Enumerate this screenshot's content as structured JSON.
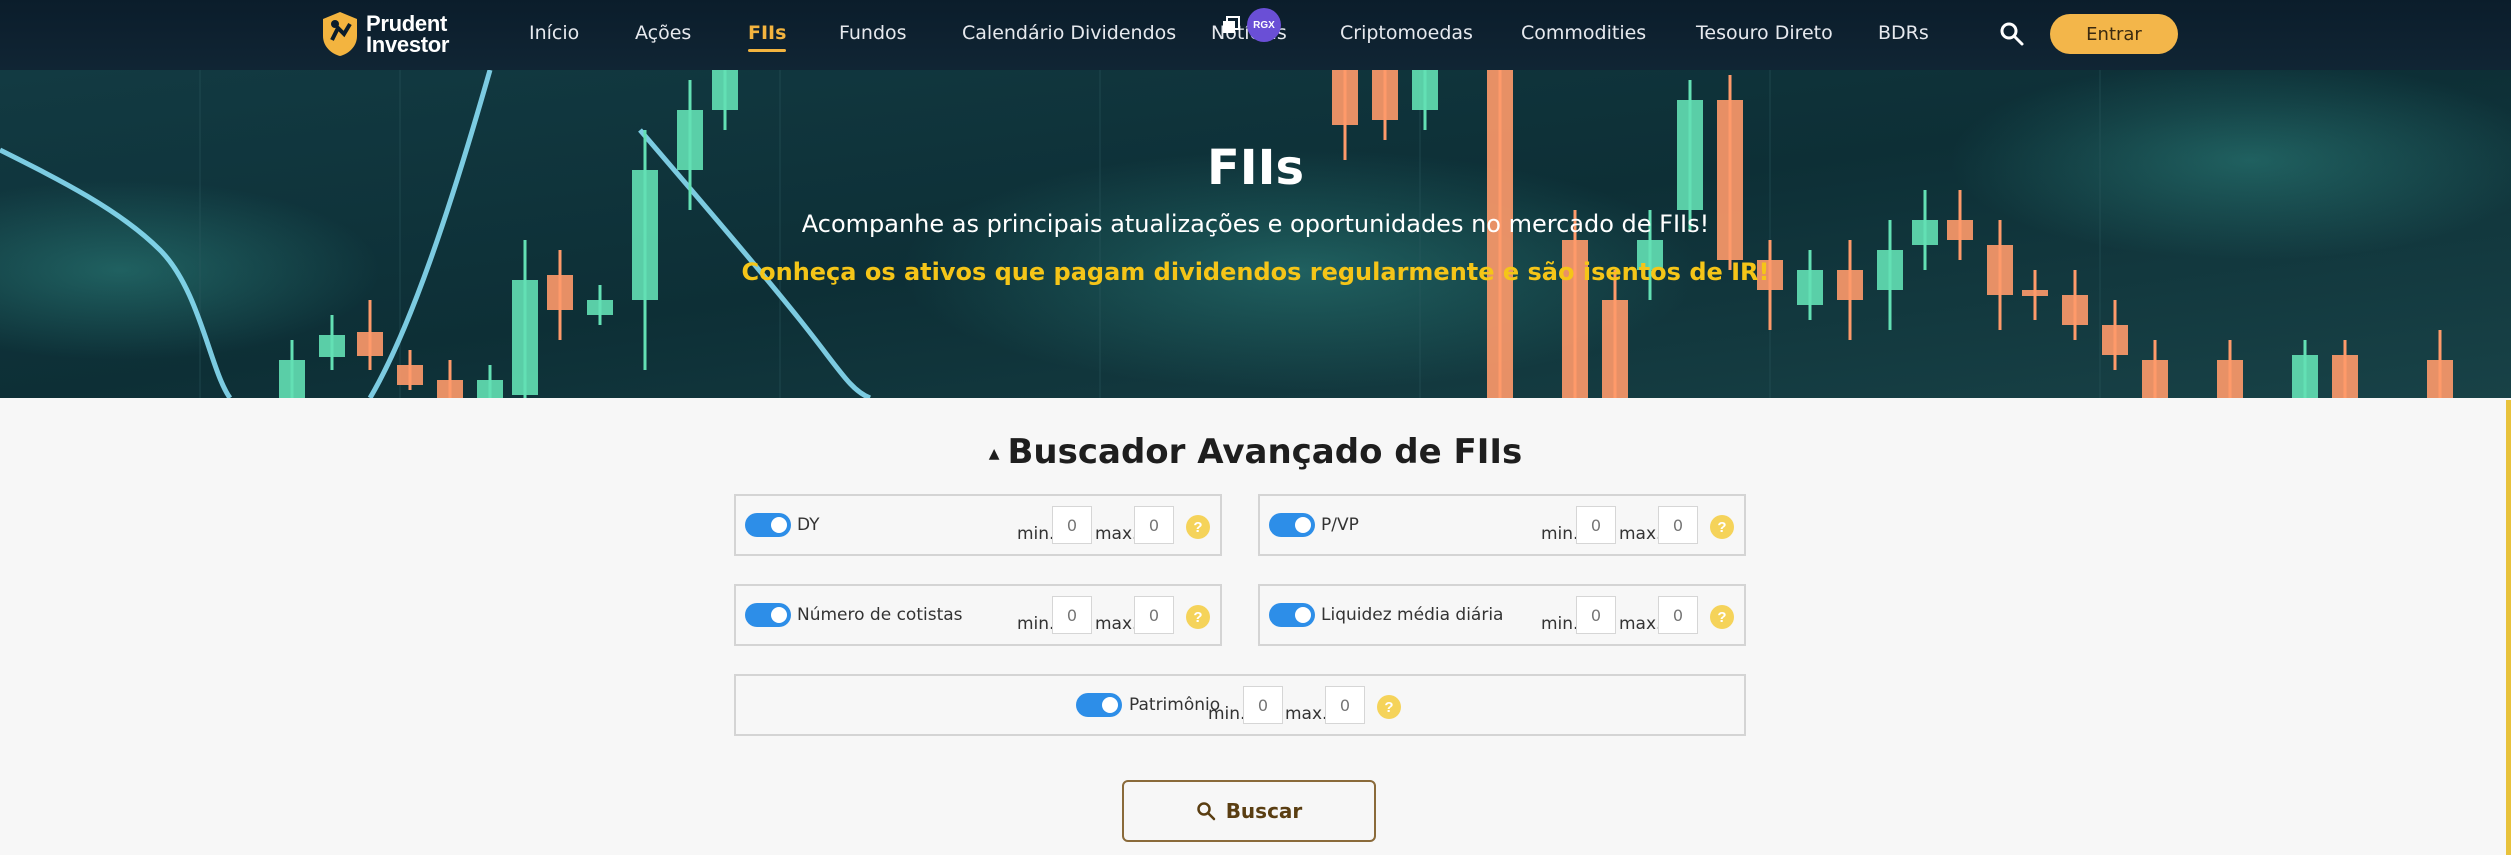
{
  "header": {
    "logo_line1": "Prudent",
    "logo_line2": "Investor",
    "nav": [
      {
        "label": "Início"
      },
      {
        "label": "Ações"
      },
      {
        "label": "FIIs",
        "active": true
      },
      {
        "label": "Fundos"
      },
      {
        "label": "Calendário Dividendos"
      },
      {
        "label": "Notícias"
      },
      {
        "label": "Criptomoedas"
      },
      {
        "label": "Commodities"
      },
      {
        "label": "Tesouro Direto"
      },
      {
        "label": "BDRs"
      }
    ],
    "login_label": "Entrar",
    "badge_label": "RGX",
    "accent_color": "#f3b43f"
  },
  "hero": {
    "title": "FIIs",
    "subtitle": "Acompanhe as principais atualizações e oportunidades no mercado de FIIs!",
    "highlight": "Conheça os ativos que pagam dividendos regularmente e são isentos de IR!"
  },
  "search": {
    "title": "Buscador Avançado de FIIs",
    "min_label": "min.",
    "max_label": "max.",
    "help_symbol": "?",
    "filters": [
      {
        "label": "DY",
        "enabled": true,
        "min_placeholder": "0",
        "max_placeholder": "0"
      },
      {
        "label": "P/VP",
        "enabled": true,
        "min_placeholder": "0",
        "max_placeholder": "0"
      },
      {
        "label": "Número de cotistas",
        "enabled": true,
        "min_placeholder": "0",
        "max_placeholder": "0"
      },
      {
        "label": "Liquidez média diária",
        "enabled": true,
        "min_placeholder": "0",
        "max_placeholder": "0"
      },
      {
        "label": "Patrimônio",
        "enabled": true,
        "min_placeholder": "0",
        "max_placeholder": "0"
      }
    ],
    "button_label": "Buscar",
    "toggle_color": "#2d8ee8"
  }
}
